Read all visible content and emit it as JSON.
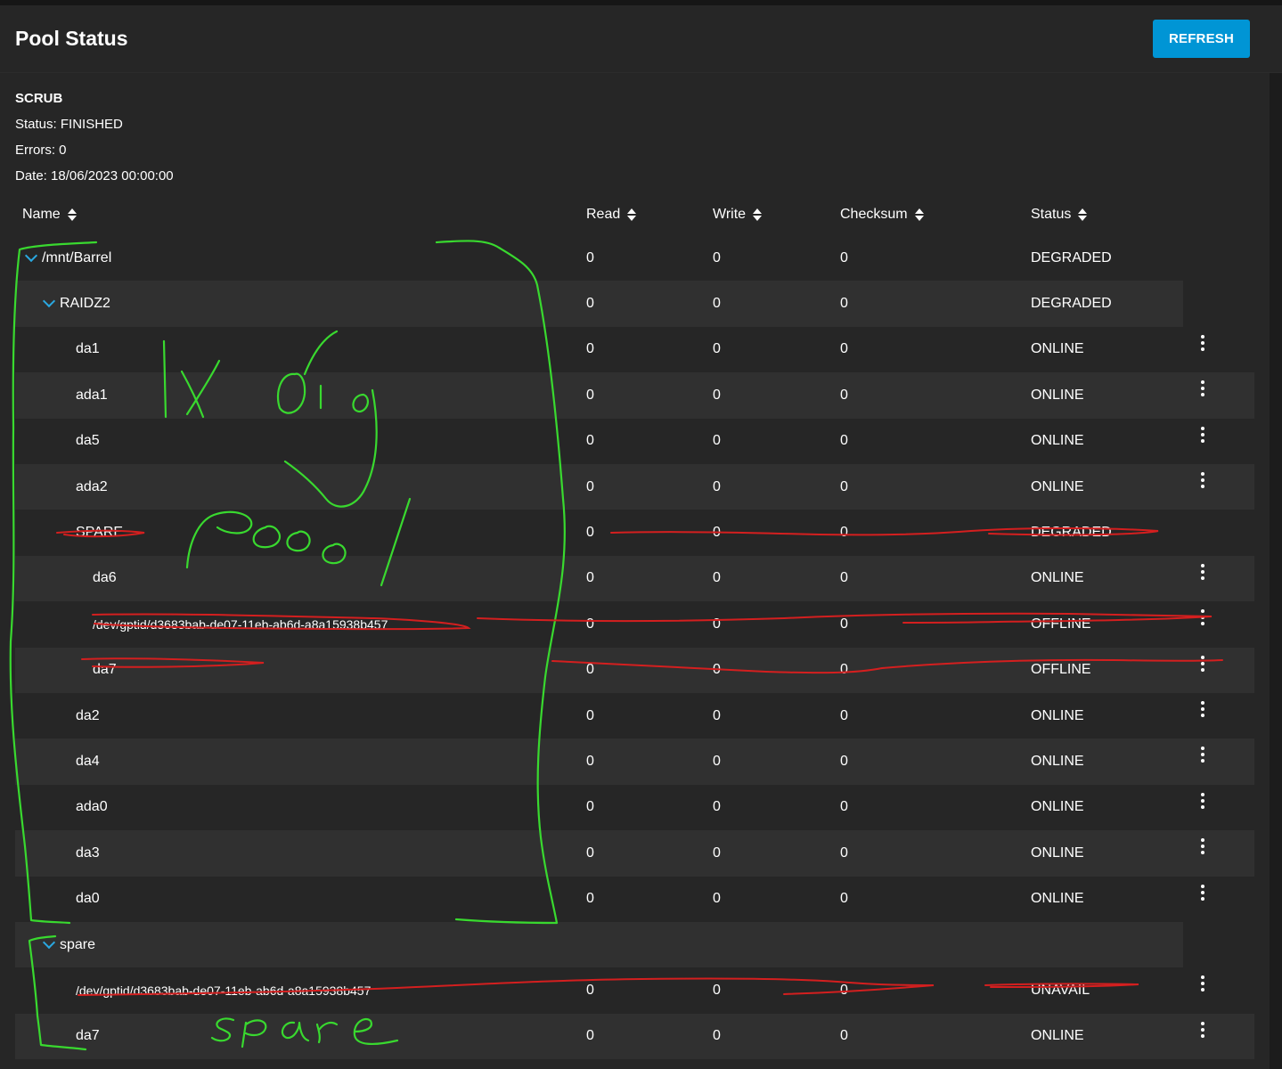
{
  "header": {
    "title": "Pool Status",
    "refresh_label": "REFRESH"
  },
  "scrub": {
    "title": "SCRUB",
    "status": "Status: FINISHED",
    "errors": "Errors: 0",
    "date": "Date: 18/06/2023 00:00:00"
  },
  "columns": [
    "Name",
    "Read",
    "Write",
    "Checksum",
    "Status"
  ],
  "rows": [
    {
      "name": "/mnt/Barrel",
      "read": "0",
      "write": "0",
      "checksum": "0",
      "status": "DEGRADED",
      "expandable": true
    },
    {
      "name": "RAIDZ2",
      "read": "0",
      "write": "0",
      "checksum": "0",
      "status": "DEGRADED",
      "expandable": true
    },
    {
      "name": "da1",
      "read": "0",
      "write": "0",
      "checksum": "0",
      "status": "ONLINE",
      "menu": true
    },
    {
      "name": "ada1",
      "read": "0",
      "write": "0",
      "checksum": "0",
      "status": "ONLINE",
      "menu": true
    },
    {
      "name": "da5",
      "read": "0",
      "write": "0",
      "checksum": "0",
      "status": "ONLINE",
      "menu": true
    },
    {
      "name": "ada2",
      "read": "0",
      "write": "0",
      "checksum": "0",
      "status": "ONLINE",
      "menu": true
    },
    {
      "name": "SPARE",
      "read": "0",
      "write": "0",
      "checksum": "0",
      "status": "DEGRADED"
    },
    {
      "name": "da6",
      "read": "0",
      "write": "0",
      "checksum": "0",
      "status": "ONLINE",
      "menu": true
    },
    {
      "name": "/dev/gptid/d3683bab-de07-11eb-ab6d-a8a15938b457",
      "read": "0",
      "write": "0",
      "checksum": "0",
      "status": "OFFLINE",
      "menu": true
    },
    {
      "name": "da7",
      "read": "0",
      "write": "0",
      "checksum": "0",
      "status": "OFFLINE",
      "menu": true
    },
    {
      "name": "da2",
      "read": "0",
      "write": "0",
      "checksum": "0",
      "status": "ONLINE",
      "menu": true
    },
    {
      "name": "da4",
      "read": "0",
      "write": "0",
      "checksum": "0",
      "status": "ONLINE",
      "menu": true
    },
    {
      "name": "ada0",
      "read": "0",
      "write": "0",
      "checksum": "0",
      "status": "ONLINE",
      "menu": true
    },
    {
      "name": "da3",
      "read": "0",
      "write": "0",
      "checksum": "0",
      "status": "ONLINE",
      "menu": true
    },
    {
      "name": "da0",
      "read": "0",
      "write": "0",
      "checksum": "0",
      "status": "ONLINE",
      "menu": true
    },
    {
      "name": "spare",
      "read": "",
      "write": "",
      "checksum": "",
      "status": "",
      "expandable": true
    },
    {
      "name": "/dev/gptid/d3683bab-de07-11eb-ab6d-a8a15938b457",
      "read": "0",
      "write": "0",
      "checksum": "0",
      "status": "UNAVAIL",
      "menu": true
    },
    {
      "name": "da7",
      "read": "0",
      "write": "0",
      "checksum": "0",
      "status": "ONLINE",
      "menu": true
    }
  ],
  "annotations": {
    "green_text_1": "1x Big pool",
    "green_text_2": "spare",
    "green_color": "#39d92f",
    "red_color": "#d41f1f"
  },
  "colors": {
    "accent": "#0095d5",
    "chevron": "#2aa8e0"
  }
}
